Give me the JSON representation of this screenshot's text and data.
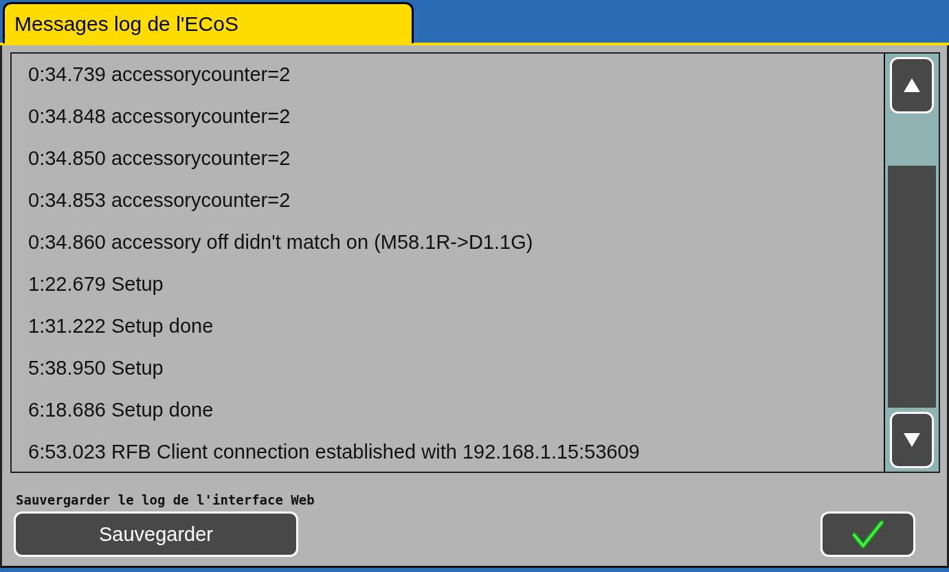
{
  "tab": {
    "label": "Messages log de l'ECoS",
    "selected": true
  },
  "log": {
    "lines": [
      "0:34.739 accessorycounter=2",
      "0:34.848 accessorycounter=2",
      "0:34.850 accessorycounter=2",
      "0:34.853 accessorycounter=2",
      "0:34.860 accessory off didn't match on (M58.1R->D1.1G)",
      "1:22.679 Setup",
      "1:31.222 Setup done",
      "5:38.950 Setup",
      "6:18.686 Setup done",
      "6:53.023 RFB Client connection established with 192.168.1.15:53609"
    ]
  },
  "save": {
    "caption": "Sauvergarder le log de l'interface Web",
    "button": "Sauvegarder"
  }
}
